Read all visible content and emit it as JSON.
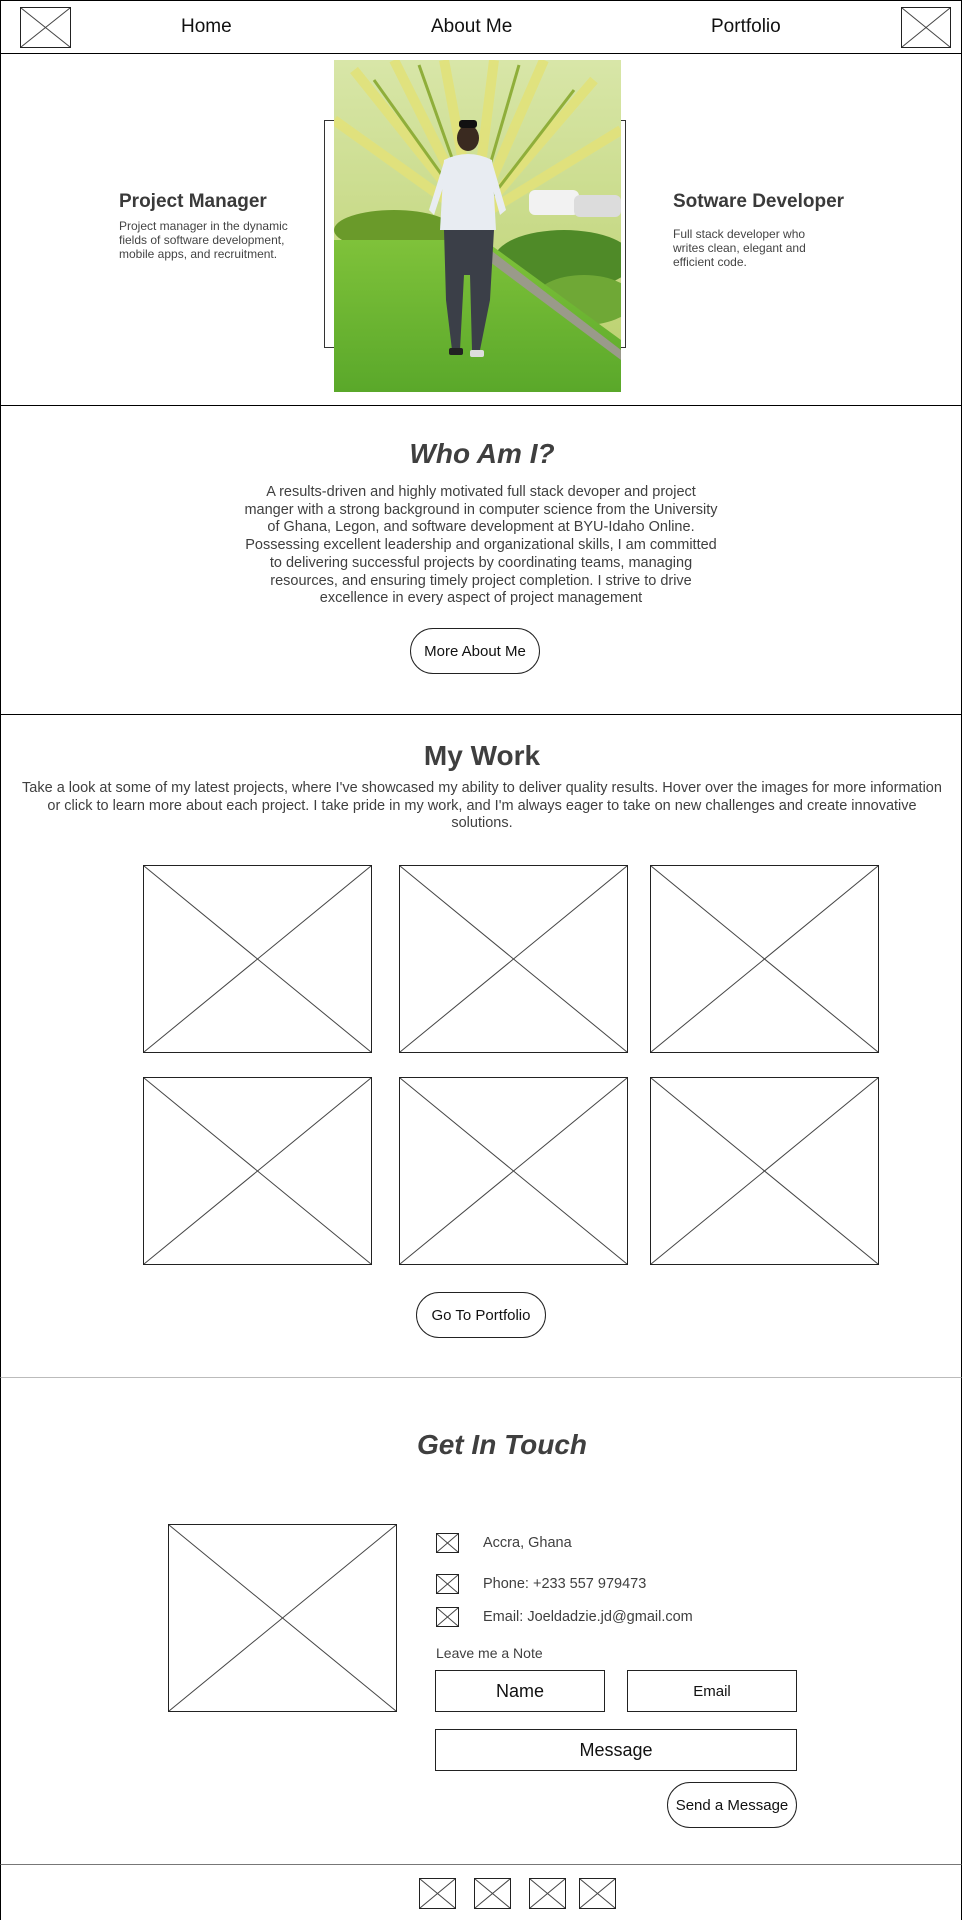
{
  "nav": {
    "logo_icon": "image-placeholder-icon",
    "links": [
      "Home",
      "About Me",
      "Portfolio"
    ],
    "profile_icon": "image-placeholder-icon"
  },
  "hero": {
    "left": {
      "title": "Project Manager",
      "text": "Project manager in the dynamic fields of software development, mobile apps, and recruitment."
    },
    "right": {
      "title": "Sotware Developer",
      "text": "Full stack developer who writes clean, elegant and efficient code."
    },
    "photo_icon": "portrait-photo"
  },
  "about": {
    "title": "Who Am I?",
    "text": "A results-driven and highly motivated full stack devoper and project manger with a strong background in computer science from the University of Ghana, Legon, and software development at BYU-Idaho Online. Possessing excellent leadership and organizational skills, I am committed to delivering successful projects by coordinating teams, managing resources, and ensuring timely project completion. I strive to drive excellence in every aspect of project management",
    "button": "More About Me"
  },
  "work": {
    "title": "My Work",
    "text": "Take a look at some of my latest projects, where I've showcased my ability to deliver quality results. Hover over the images for more information or click to learn more about each project. I take pride in my work, and I'm always eager to take on new challenges and create innovative solutions.",
    "button": "Go To Portfolio"
  },
  "contact": {
    "title": "Get In Touch",
    "location": "Accra, Ghana",
    "phone": "Phone: +233 557 979473",
    "email": "Email: Joeldadzie.jd@gmail.com",
    "note_label": "Leave me a Note",
    "name_placeholder": "Name",
    "email_placeholder": "Email",
    "message_placeholder": "Message",
    "send_button": "Send a Message"
  },
  "footer": {
    "social_icons": [
      "social-icon-1",
      "social-icon-2",
      "social-icon-3",
      "social-icon-4"
    ]
  }
}
